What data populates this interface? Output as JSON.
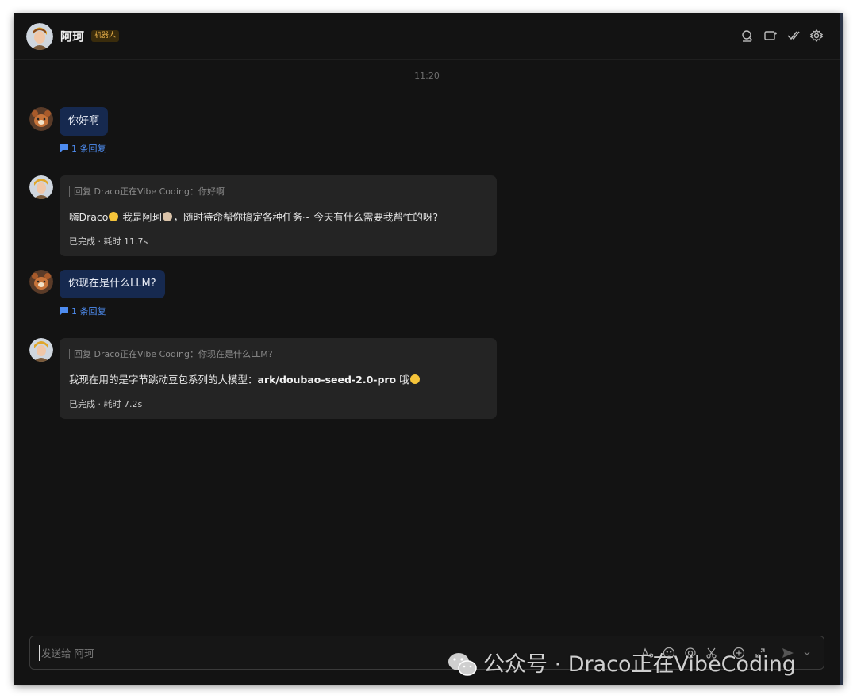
{
  "header": {
    "name": "阿珂",
    "badge": "机器人",
    "icons": [
      "search-icon",
      "add-tab-icon",
      "check-done-icon",
      "gear-icon"
    ]
  },
  "chat": {
    "time": "11:20",
    "messages": [
      {
        "role": "user",
        "text": "你好啊",
        "reply_count": "1 条回复"
      },
      {
        "role": "bot",
        "quote": "回复 Draco正在Vibe Coding：你好啊",
        "text_before": "嗨Draco",
        "text_mid": " 我是阿珂",
        "text_after": "，随时待命帮你搞定各种任务~ 今天有什么需要我帮忙的呀?",
        "status": "已完成 · 耗时 11.7s"
      },
      {
        "role": "user",
        "text": "你现在是什么LLM?",
        "reply_count": "1 条回复"
      },
      {
        "role": "bot",
        "quote": "回复 Draco正在Vibe Coding：你现在是什么LLM?",
        "text_before": "我现在用的是字节跳动豆包系列的大模型：",
        "text_bold": "ark/doubao-seed-2.0-pro",
        "text_after": " 哦",
        "status": "已完成 · 耗时 7.2s"
      }
    ]
  },
  "composer": {
    "placeholder": "发送给 阿珂",
    "tool_icons": [
      "text-format-icon",
      "emoji-icon",
      "mention-icon",
      "scissors-icon",
      "plus-icon",
      "expand-icon",
      "send-icon",
      "chevron-down-icon"
    ]
  },
  "watermark": {
    "text": "公众号 · Draco正在VibeCoding"
  },
  "colors": {
    "background": "#131313",
    "user_bubble": "#16294f",
    "bot_card": "#242424",
    "link": "#4e8cf0",
    "badge_text": "#e8b04a"
  }
}
